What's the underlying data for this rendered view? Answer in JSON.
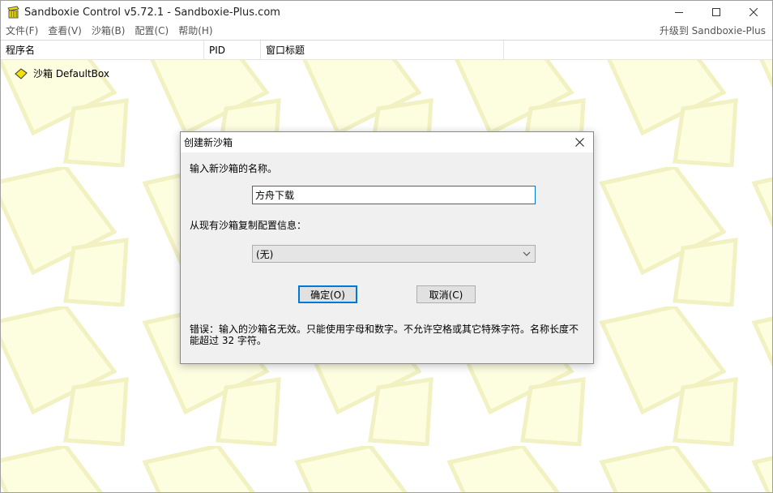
{
  "window": {
    "title": "Sandboxie Control v5.72.1 - Sandboxie-Plus.com"
  },
  "menu": {
    "items": [
      "文件(F)",
      "查看(V)",
      "沙箱(B)",
      "配置(C)",
      "帮助(H)"
    ],
    "upgrade": "升级到 Sandboxie-Plus"
  },
  "list": {
    "columns": [
      "程序名",
      "PID",
      "窗口标题"
    ],
    "rows": [
      {
        "label": "沙箱 DefaultBox",
        "icon": "sandbox-diamond-icon"
      }
    ]
  },
  "dialog": {
    "title": "创建新沙箱",
    "name_prompt": "输入新沙箱的名称。",
    "name_value": "方舟下载",
    "copy_prompt": "从现有沙箱复制配置信息：",
    "copy_selected": "(无)",
    "ok_label": "确定(O)",
    "cancel_label": "取消(C)",
    "error": "错误：输入的沙箱名无效。只能使用字母和数字。不允许空格或其它特殊字符。名称长度不能超过 32 字符。"
  },
  "colors": {
    "accent": "#0078d7",
    "bg_tile": "#fdfde0",
    "bg_tile_stroke": "#f1f1c2",
    "sandbox_icon": "#f2e200"
  }
}
